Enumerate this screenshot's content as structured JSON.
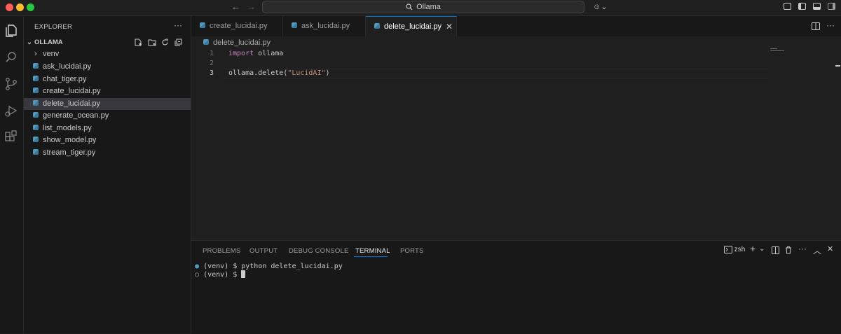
{
  "window": {
    "command_center_label": "Ollama",
    "traffic_lights": {
      "close": "#ff5f57",
      "minimize": "#febc2e",
      "zoom": "#28c840"
    }
  },
  "sidebar": {
    "title": "EXPLORER",
    "more_label": "···",
    "folder": "OLLAMA",
    "items": [
      {
        "label": "venv",
        "type": "folder"
      },
      {
        "label": "ask_lucidai.py",
        "type": "file"
      },
      {
        "label": "chat_tiger.py",
        "type": "file"
      },
      {
        "label": "create_lucidai.py",
        "type": "file"
      },
      {
        "label": "delete_lucidai.py",
        "type": "file",
        "selected": true
      },
      {
        "label": "generate_ocean.py",
        "type": "file"
      },
      {
        "label": "list_models.py",
        "type": "file"
      },
      {
        "label": "show_model.py",
        "type": "file"
      },
      {
        "label": "stream_tiger.py",
        "type": "file"
      }
    ]
  },
  "tabs": [
    {
      "label": "create_lucidai.py",
      "active": false
    },
    {
      "label": "ask_lucidai.py",
      "active": false
    },
    {
      "label": "delete_lucidai.py",
      "active": true
    }
  ],
  "editor": {
    "breadcrumb": "delete_lucidai.py",
    "lines": [
      {
        "number": "1",
        "keyword": "import",
        "rest": " ollama",
        "string": "",
        "tail": ""
      },
      {
        "number": "2",
        "keyword": "",
        "rest": "",
        "string": "",
        "tail": ""
      },
      {
        "number": "3",
        "keyword": "",
        "rest": "ollama.delete(",
        "string": "\"LucidAI\"",
        "tail": ")"
      }
    ],
    "current_line": "3"
  },
  "panel": {
    "tabs": [
      "PROBLEMS",
      "OUTPUT",
      "DEBUG CONSOLE",
      "TERMINAL",
      "PORTS"
    ],
    "active_tab": "TERMINAL",
    "shell_label": "zsh",
    "terminal_lines": [
      {
        "marker": "●",
        "text": "(venv) $ python delete_lucidai.py"
      },
      {
        "marker": "○",
        "text": "(venv) $ "
      }
    ]
  },
  "colors": {
    "accent": "#0078d4",
    "python_icon": "#519aba",
    "keyword": "#c586c0",
    "string": "#ce9178"
  }
}
